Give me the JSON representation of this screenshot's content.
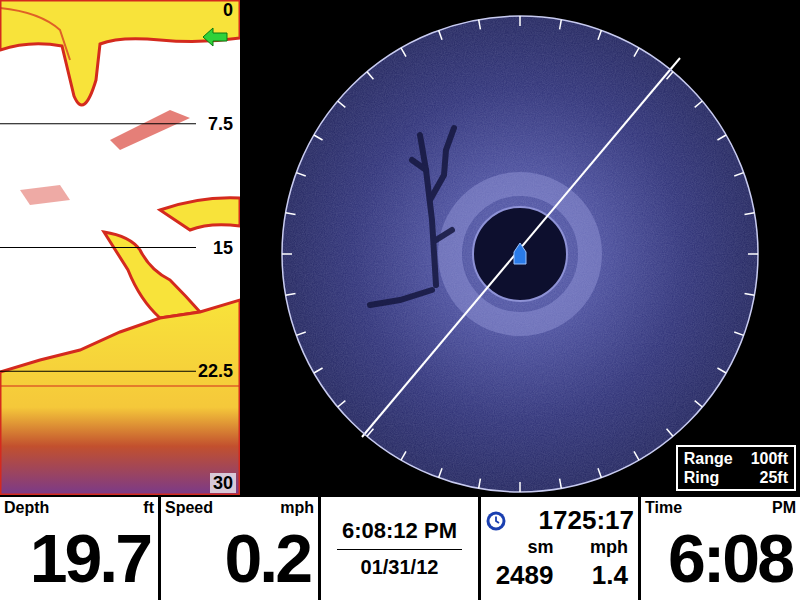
{
  "sonar_panel": {
    "depth_labels": [
      "0",
      "7.5",
      "15",
      "22.5",
      "30"
    ]
  },
  "imaging_panel": {
    "range": {
      "label": "Range",
      "value": "100ft"
    },
    "ring": {
      "label": "Ring",
      "value": "25ft"
    }
  },
  "readouts": [
    {
      "kind": "big",
      "label": "Depth",
      "unit": "ft",
      "value": "19.7"
    },
    {
      "kind": "big",
      "label": "Speed",
      "unit": "mph",
      "value": "0.2"
    },
    {
      "kind": "clock",
      "time": "6:08:12 PM",
      "date": "01/31/12"
    },
    {
      "kind": "trip",
      "timer": "1725:17",
      "units": [
        "sm",
        "mph"
      ],
      "values": [
        "2489",
        "1.4"
      ]
    },
    {
      "kind": "big",
      "label": "Time",
      "unit": "PM",
      "value": "6:08"
    }
  ]
}
